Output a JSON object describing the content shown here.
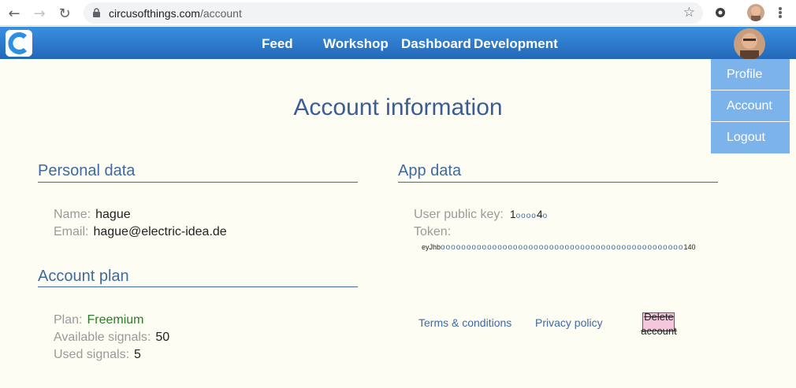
{
  "browser": {
    "url_host": "circusofthings.com",
    "url_path": "/account"
  },
  "nav": {
    "links": [
      "Feed",
      "Workshop",
      "Dashboard",
      "Development"
    ]
  },
  "menu": {
    "items": [
      "Profile",
      "Account",
      "Logout"
    ]
  },
  "page": {
    "title": "Account information"
  },
  "personal": {
    "title": "Personal data",
    "name_label": "Name:",
    "name_value": "hague",
    "email_label": "Email:",
    "email_value": "hague@electric-idea.de"
  },
  "plan": {
    "title": "Account plan",
    "plan_label": "Plan:",
    "plan_value": "Freemium",
    "available_label": "Available signals:",
    "available_value": "50",
    "used_label": "Used signals:",
    "used_value": "5"
  },
  "app": {
    "title": "App data",
    "key_label": "User public key:",
    "key_prefix": "1",
    "key_masked": "oooo",
    "key_mid": "4",
    "key_masked2": "o",
    "token_label": "Token:",
    "token_prefix": "eyJhb",
    "token_masked": "ooooooooooooooooooooooooooooooooooooooooooooooo",
    "token_suffix": "140"
  },
  "footer": {
    "terms": "Terms & conditions",
    "privacy": "Privacy policy",
    "delete": "Delete account"
  }
}
